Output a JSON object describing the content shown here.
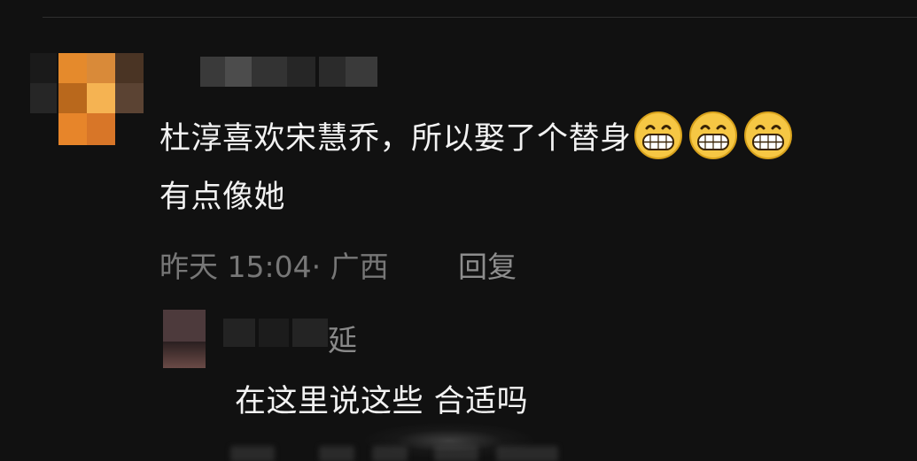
{
  "main_comment": {
    "username": "",
    "text": "杜淳喜欢宋慧乔，所以娶了个替身",
    "text_line2": "有点像她",
    "emojis": [
      "grinning-face-icon",
      "grinning-face-icon",
      "grinning-face-icon"
    ],
    "time": "昨天 15:04",
    "separator": "·",
    "location": "广西",
    "reply_label": "回复"
  },
  "reply_comment": {
    "username_visible_char": "延",
    "text": "在这里说这些 合适吗"
  },
  "colors": {
    "background": "#111111",
    "primary_text": "#f2f2f2",
    "secondary_text": "#777777",
    "emoji_yellow": "#f6c744"
  }
}
